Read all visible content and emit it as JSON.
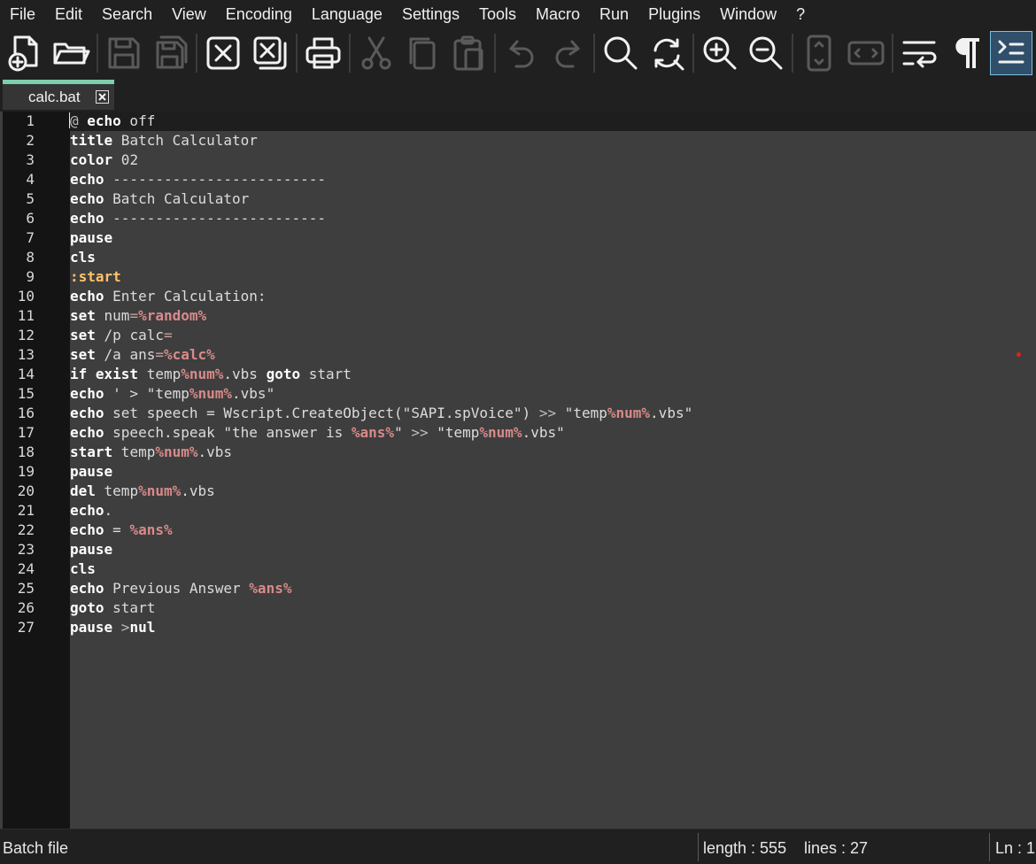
{
  "menu": [
    "File",
    "Edit",
    "Search",
    "View",
    "Encoding",
    "Language",
    "Settings",
    "Tools",
    "Macro",
    "Run",
    "Plugins",
    "Window",
    "?"
  ],
  "toolbar": [
    {
      "icon": "new-file-icon",
      "enabled": true
    },
    {
      "icon": "open-folder-icon",
      "enabled": true
    },
    {
      "icon": "save-icon",
      "enabled": false
    },
    {
      "icon": "save-all-icon",
      "enabled": false
    },
    {
      "icon": "close-icon",
      "enabled": true
    },
    {
      "icon": "close-all-icon",
      "enabled": true
    },
    {
      "icon": "print-icon",
      "enabled": true
    },
    {
      "icon": "cut-icon",
      "enabled": false
    },
    {
      "icon": "copy-icon",
      "enabled": false
    },
    {
      "icon": "paste-icon",
      "enabled": false
    },
    {
      "icon": "undo-icon",
      "enabled": false
    },
    {
      "icon": "redo-icon",
      "enabled": false
    },
    {
      "icon": "find-icon",
      "enabled": true
    },
    {
      "icon": "replace-icon",
      "enabled": true
    },
    {
      "icon": "zoom-in-icon",
      "enabled": true
    },
    {
      "icon": "zoom-out-icon",
      "enabled": true
    },
    {
      "icon": "sync-vertical-icon",
      "enabled": false
    },
    {
      "icon": "sync-horizontal-icon",
      "enabled": false
    },
    {
      "icon": "word-wrap-icon",
      "enabled": true
    },
    {
      "icon": "show-all-characters-icon",
      "enabled": true
    },
    {
      "icon": "indent-guide-icon",
      "enabled": true
    }
  ],
  "tab": {
    "title": "calc.bat",
    "active": true
  },
  "colors": {
    "background": "#202020",
    "editor": "#3e3e3e",
    "gutter": "#141414",
    "current_line": "#1e1e1e",
    "keyword": "#ffffff",
    "variable": "#d98a8a",
    "label": "#ffc26a",
    "text": "#dcdcdc",
    "tab_accent": "#7ecfae",
    "change_marker": "#e02020"
  },
  "editor": {
    "current_line": 1,
    "lines": [
      {
        "n": "1",
        "t": [
          [
            "sym",
            "@ "
          ],
          [
            "kw",
            "echo"
          ],
          [
            "tx",
            " off"
          ]
        ]
      },
      {
        "n": "2",
        "t": [
          [
            "kw",
            "title"
          ],
          [
            "tx",
            " Batch Calculator"
          ]
        ]
      },
      {
        "n": "3",
        "t": [
          [
            "kw",
            "color"
          ],
          [
            "tx",
            " 02"
          ]
        ]
      },
      {
        "n": "4",
        "t": [
          [
            "kw",
            "echo"
          ],
          [
            "tx",
            " -------------------------"
          ]
        ]
      },
      {
        "n": "5",
        "t": [
          [
            "kw",
            "echo"
          ],
          [
            "tx",
            " Batch Calculator"
          ]
        ]
      },
      {
        "n": "6",
        "t": [
          [
            "kw",
            "echo"
          ],
          [
            "tx",
            " -------------------------"
          ]
        ]
      },
      {
        "n": "7",
        "t": [
          [
            "kw",
            "pause"
          ]
        ]
      },
      {
        "n": "8",
        "t": [
          [
            "kw",
            "cls"
          ]
        ]
      },
      {
        "n": "9",
        "t": [
          [
            "label",
            ":start"
          ]
        ]
      },
      {
        "n": "10",
        "t": [
          [
            "kw",
            "echo"
          ],
          [
            "tx",
            " Enter Calculation:"
          ]
        ]
      },
      {
        "n": "11",
        "t": [
          [
            "kw",
            "set"
          ],
          [
            "tx",
            " num"
          ],
          [
            "op",
            "="
          ],
          [
            "var",
            "%random%"
          ]
        ]
      },
      {
        "n": "12",
        "t": [
          [
            "kw",
            "set"
          ],
          [
            "tx",
            " /p calc"
          ],
          [
            "op",
            "="
          ]
        ]
      },
      {
        "n": "13",
        "t": [
          [
            "kw",
            "set"
          ],
          [
            "tx",
            " /a ans"
          ],
          [
            "op",
            "="
          ],
          [
            "var",
            "%calc%"
          ]
        ]
      },
      {
        "n": "14",
        "t": [
          [
            "kw",
            "if exist"
          ],
          [
            "tx",
            " temp"
          ],
          [
            "var",
            "%num%"
          ],
          [
            "tx",
            ".vbs "
          ],
          [
            "kw",
            "goto"
          ],
          [
            "tx",
            " start"
          ]
        ]
      },
      {
        "n": "15",
        "t": [
          [
            "kw",
            "echo"
          ],
          [
            "tx",
            " ' > \"temp"
          ],
          [
            "var",
            "%num%"
          ],
          [
            "tx",
            ".vbs\""
          ]
        ]
      },
      {
        "n": "16",
        "t": [
          [
            "kw",
            "echo"
          ],
          [
            "tx",
            " set speech = Wscript.CreateObject(\"SAPI.spVoice\") "
          ],
          [
            "sym",
            ">>"
          ],
          [
            "tx",
            " \"temp"
          ],
          [
            "var",
            "%num%"
          ],
          [
            "tx",
            ".vbs\""
          ]
        ]
      },
      {
        "n": "17",
        "t": [
          [
            "kw",
            "echo"
          ],
          [
            "tx",
            " speech.speak \"the answer is "
          ],
          [
            "var",
            "%ans%"
          ],
          [
            "tx",
            "\" "
          ],
          [
            "sym",
            ">>"
          ],
          [
            "tx",
            " \"temp"
          ],
          [
            "var",
            "%num%"
          ],
          [
            "tx",
            ".vbs\""
          ]
        ]
      },
      {
        "n": "18",
        "t": [
          [
            "kw",
            "start"
          ],
          [
            "tx",
            " temp"
          ],
          [
            "var",
            "%num%"
          ],
          [
            "tx",
            ".vbs"
          ]
        ]
      },
      {
        "n": "19",
        "t": [
          [
            "kw",
            "pause"
          ]
        ]
      },
      {
        "n": "20",
        "t": [
          [
            "kw",
            "del"
          ],
          [
            "tx",
            " temp"
          ],
          [
            "var",
            "%num%"
          ],
          [
            "tx",
            ".vbs"
          ]
        ]
      },
      {
        "n": "21",
        "t": [
          [
            "kw",
            "echo"
          ],
          [
            "tx",
            "."
          ]
        ]
      },
      {
        "n": "22",
        "t": [
          [
            "kw",
            "echo"
          ],
          [
            "tx",
            " = "
          ],
          [
            "var",
            "%ans%"
          ]
        ]
      },
      {
        "n": "23",
        "t": [
          [
            "kw",
            "pause"
          ]
        ]
      },
      {
        "n": "24",
        "t": [
          [
            "kw",
            "cls"
          ]
        ]
      },
      {
        "n": "25",
        "t": [
          [
            "kw",
            "echo"
          ],
          [
            "tx",
            " Previous Answer "
          ],
          [
            "var",
            "%ans%"
          ]
        ]
      },
      {
        "n": "26",
        "t": [
          [
            "kw",
            "goto"
          ],
          [
            "tx",
            " start"
          ]
        ]
      },
      {
        "n": "27",
        "t": [
          [
            "kw",
            "pause"
          ],
          [
            "sym",
            " >"
          ],
          [
            "kw",
            "nul"
          ]
        ]
      }
    ]
  },
  "status": {
    "file_type": "Batch file",
    "length": "length : 555",
    "lines": "lines : 27",
    "position": "Ln : 1"
  }
}
